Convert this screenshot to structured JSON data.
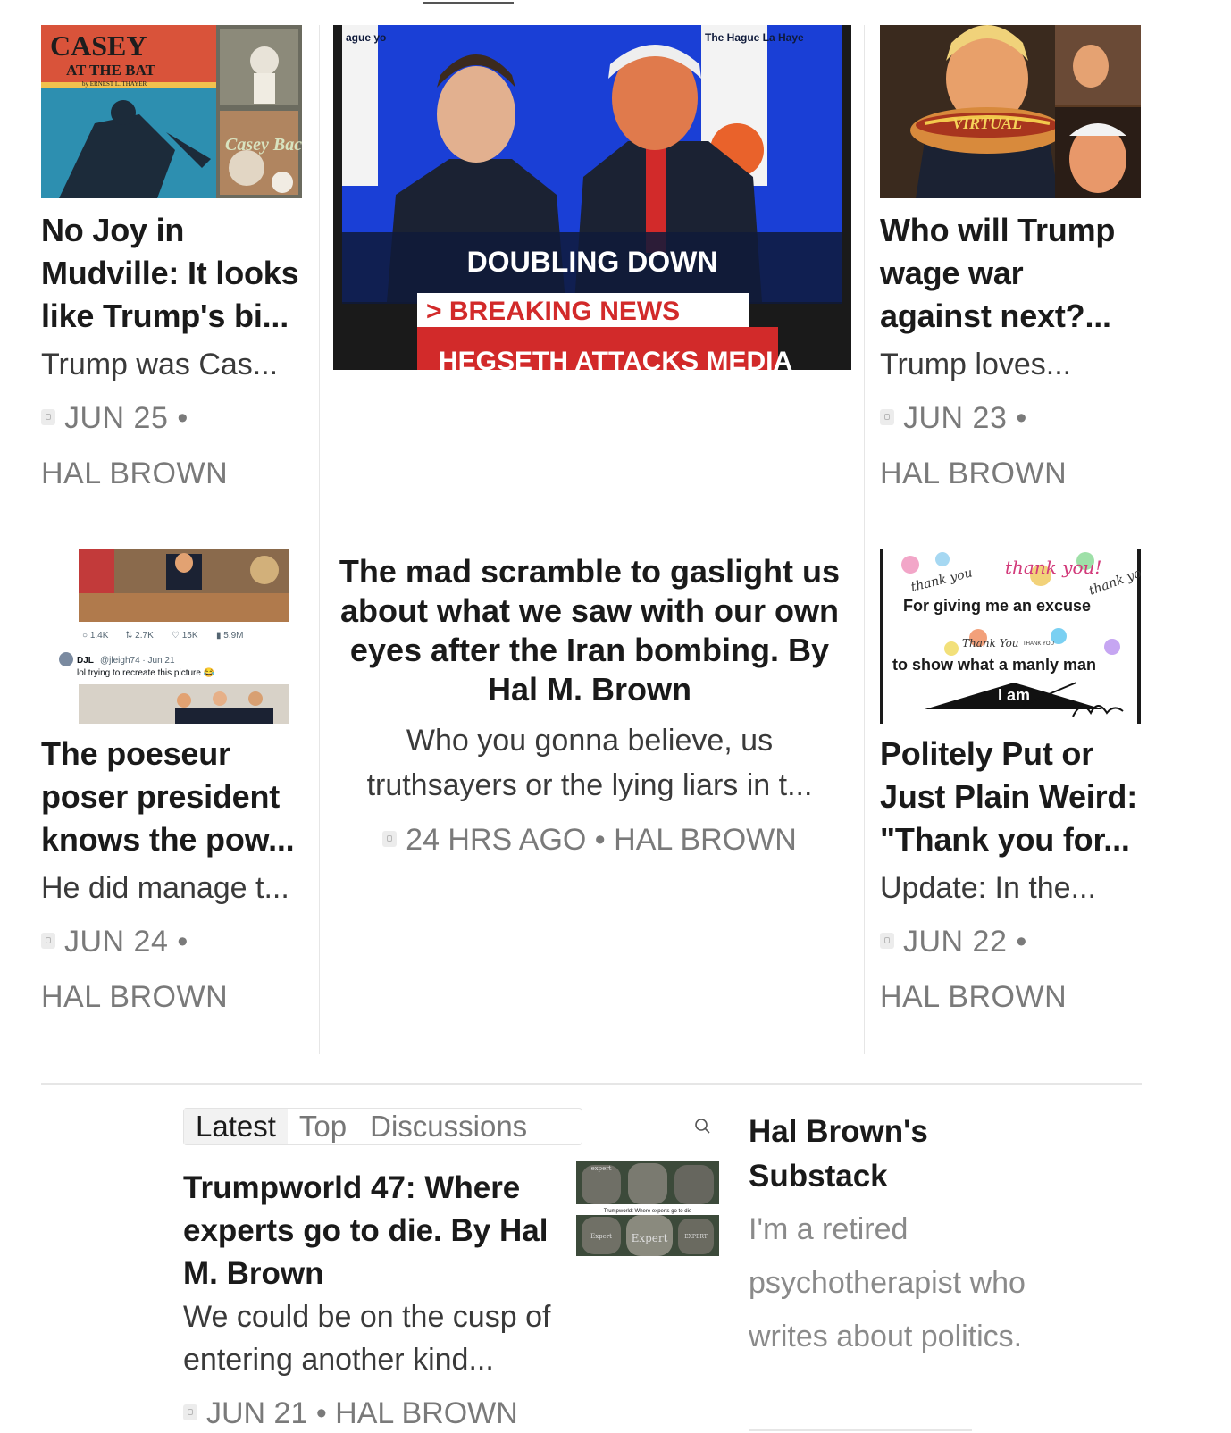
{
  "cards": [
    {
      "title": "No Joy in Mudville: It looks like Trump's bi...",
      "subtitle": "Trump was Cas...",
      "date": "JUN 25 •",
      "author": "HAL BROWN",
      "image": {
        "cover_title": "CASEY",
        "cover_subtitle": "AT THE BAT",
        "cover_byline": "by ERNEST L. THAYER",
        "second_title": "Casey Back"
      }
    },
    {
      "image": {
        "banner": "DOUBLING DOWN",
        "breaking": "> BREAKING NEWS",
        "ticker": "HEGSETH ATTACKS MEDIA",
        "sign_left": "ague yo",
        "sign_right": "The Hague La Haye"
      }
    },
    {
      "title": "Who will Trump wage war against next?...",
      "subtitle": "Trump loves...",
      "date": "JUN 23 •",
      "author": "HAL BROWN",
      "image": {
        "label": "VIRTUAL"
      }
    },
    {
      "title": "The poeseur poser president knows the pow...",
      "subtitle": "He did manage t...",
      "date": "JUN 24 •",
      "author": "HAL BROWN",
      "image": {
        "stats": [
          "1.4K",
          "2.7K",
          "15K",
          "5.9M"
        ],
        "handle": "DJL",
        "handle_meta": "@jleigh74 · Jun 21",
        "tweet": "lol trying to recreate this picture 😂"
      }
    },
    {
      "title": "The mad scramble to gaslight us about what we saw with our own eyes after the Iran bombing. By Hal M. Brown",
      "subtitle": "Who you gonna believe, us truthsayers or the lying liars in t...",
      "meta": "24 HRS AGO • HAL BROWN"
    },
    {
      "title": "Politely Put or Just Plain Weird: \"Thank you for...",
      "subtitle": "Update: In the...",
      "date": "JUN 22 •",
      "author": "HAL BROWN",
      "image": {
        "line1": "For giving me an excuse",
        "line2": "to show what a manly man",
        "line3": "I am",
        "script1": "thank you!",
        "script2": "thank you",
        "script3": "Thank You",
        "script4": "thank you",
        "small": "THANK YOU"
      }
    }
  ],
  "tabs": [
    {
      "label": "Latest",
      "active": true
    },
    {
      "label": "Top",
      "active": false
    },
    {
      "label": "Discussions",
      "active": false
    }
  ],
  "bottom_post": {
    "title": "Trumpworld 47: Where experts go to die. By Hal M. Brown",
    "subtitle": "We could be on the cusp of entering another kind...",
    "meta": "JUN 21 • HAL BROWN",
    "image": {
      "caption": "Trumpworld: Where experts go to die",
      "stone1": "Expert",
      "stone2": "expert",
      "stone3": "Expert",
      "stone4": "EXPERT"
    }
  },
  "publication": {
    "name": "Hal Brown's Substack",
    "description": "I'm a retired psychotherapist who writes about politics."
  },
  "colors": {
    "news_red": "#d22a2a",
    "news_blue": "#1a3fd6",
    "meta_gray": "#7a7a7a"
  }
}
